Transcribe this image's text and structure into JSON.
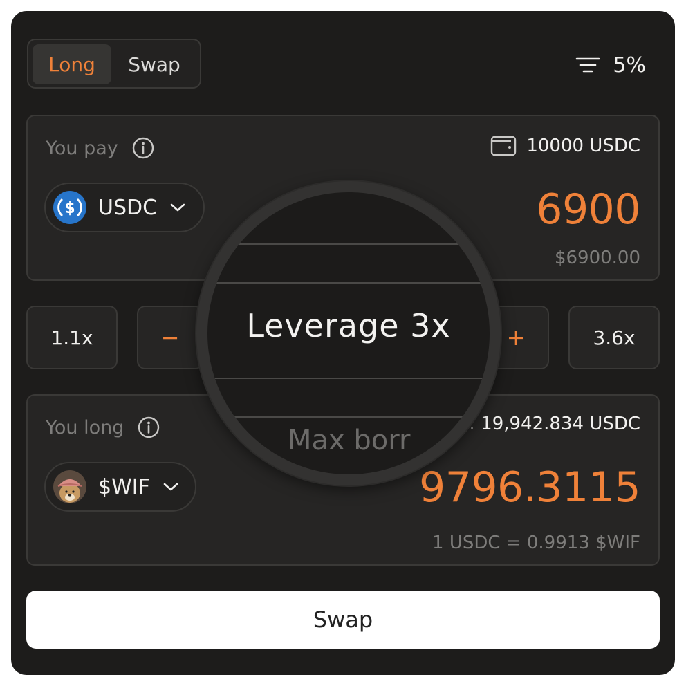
{
  "tabs": [
    {
      "label": "Long",
      "active": true
    },
    {
      "label": "Swap",
      "active": false
    }
  ],
  "slippage": {
    "icon": "filter-icon",
    "value": "5%"
  },
  "pay": {
    "label": "You pay",
    "info_icon": "info-icon",
    "wallet_icon": "wallet-icon",
    "balance": "10000 USDC",
    "token": {
      "symbol": "USDC",
      "icon": "usdc-logo-icon"
    },
    "amount": "6900",
    "usd_value": "$6900.00"
  },
  "leverage": {
    "min": "1.1x",
    "max": "3.6x",
    "decrease": "−",
    "increase": "+",
    "label": "Leverage 3x"
  },
  "long": {
    "label": "You long",
    "info_icon": "info-icon",
    "max_borrow_partial": ":",
    "max_borrow_value": "19,942.834 USDC",
    "max_borrow_ghost": "Max borr",
    "token": {
      "symbol": "$WIF",
      "icon": "wif-logo-icon"
    },
    "amount": "9796.3115",
    "rate": "1 USDC = 0.9913 $WIF"
  },
  "action": {
    "label": "Swap"
  },
  "colors": {
    "accent": "#ef8139",
    "background": "#1d1c1b",
    "panel": "#262524",
    "border": "#3a3937"
  }
}
